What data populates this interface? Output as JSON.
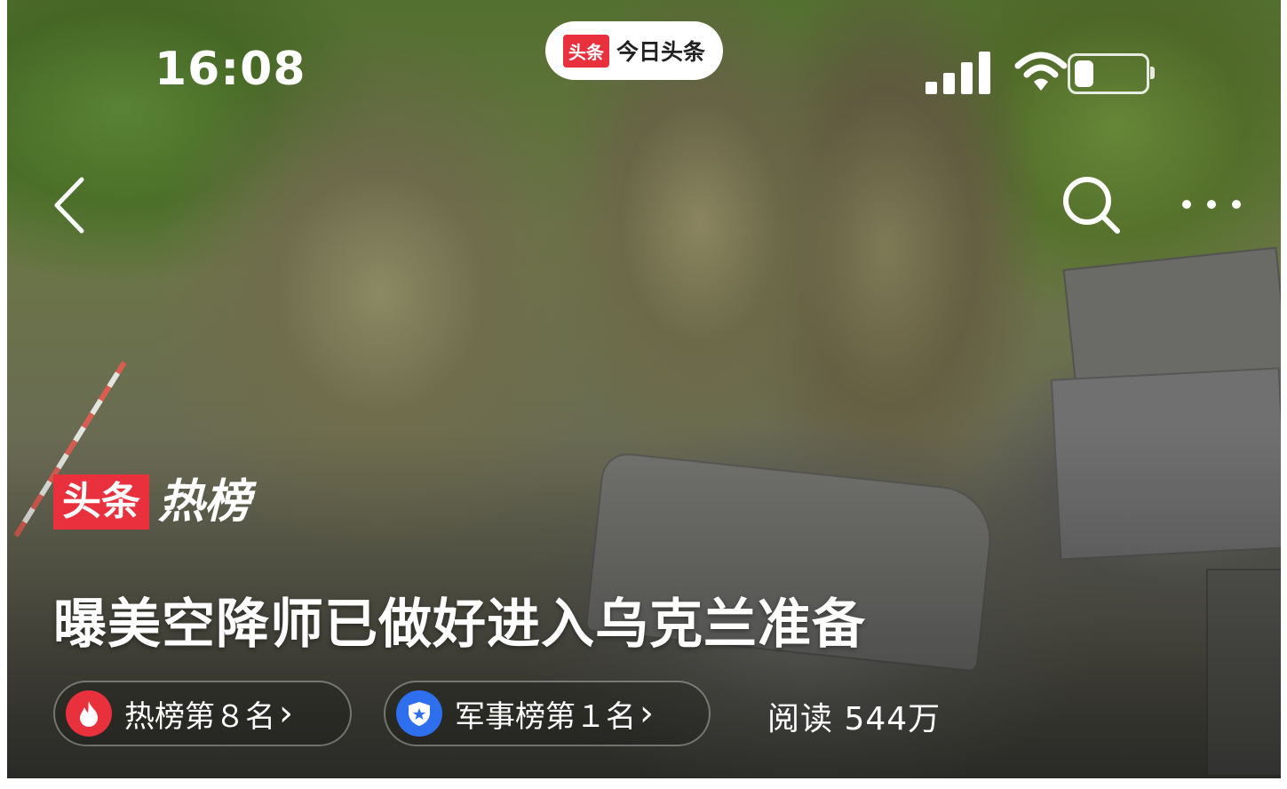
{
  "status_bar": {
    "time": "16:08",
    "app_name": "今日头条",
    "app_logo_text": "头条",
    "icons": [
      "signal-icon",
      "wifi-icon",
      "battery-icon"
    ],
    "battery_level": 0.3
  },
  "nav": {
    "back_icon": "chevron-left-icon",
    "search_icon": "search-icon",
    "more_icon": "more-icon"
  },
  "hero": {
    "badge": "头条",
    "badge_suffix": "热榜",
    "headline": "曝美空降师已做好进入乌克兰准备"
  },
  "chips": {
    "hot_rank": "热榜第８名",
    "hot_rank_icon": "flame-icon",
    "military_rank": "军事榜第１名",
    "military_rank_icon": "shield-icon",
    "chevron": "›"
  },
  "stats": {
    "reads": "阅读 544万"
  },
  "colors": {
    "accent_red": "#e8313d",
    "accent_blue": "#2e6ff0"
  }
}
